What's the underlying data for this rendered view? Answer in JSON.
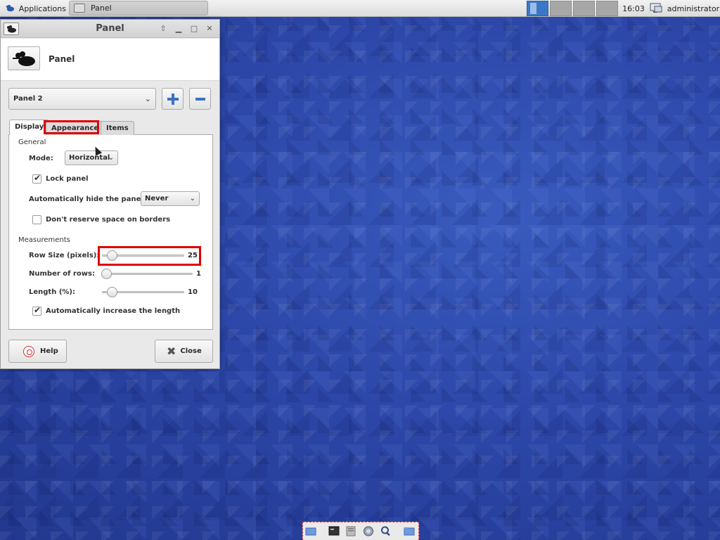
{
  "top_panel": {
    "applications_label": "Applications",
    "task_label": "Panel",
    "clock": "16:03",
    "user": "administrator"
  },
  "window": {
    "title": "Panel",
    "header_title": "Panel",
    "panel_selector": "Panel 2",
    "tabs": [
      {
        "label": "Display"
      },
      {
        "label": "Appearance"
      },
      {
        "label": "Items"
      }
    ],
    "display": {
      "general_heading": "General",
      "mode_label": "Mode:",
      "mode_value": "Horizontal",
      "lock_panel_label": "Lock panel",
      "lock_panel_checked": true,
      "autohide_label": "Automatically hide the panel:",
      "autohide_value": "Never",
      "reserve_space_label": "Don't reserve space on borders",
      "reserve_space_checked": false,
      "measurements_heading": "Measurements",
      "row_size_label": "Row Size (pixels):",
      "row_size_value": "25",
      "rows_label": "Number of rows:",
      "rows_value": "1",
      "length_label": "Length (%):",
      "length_value": "10",
      "auto_length_label": "Automatically increase the length",
      "auto_length_checked": true
    },
    "help_label": "Help",
    "close_label": "Close"
  }
}
